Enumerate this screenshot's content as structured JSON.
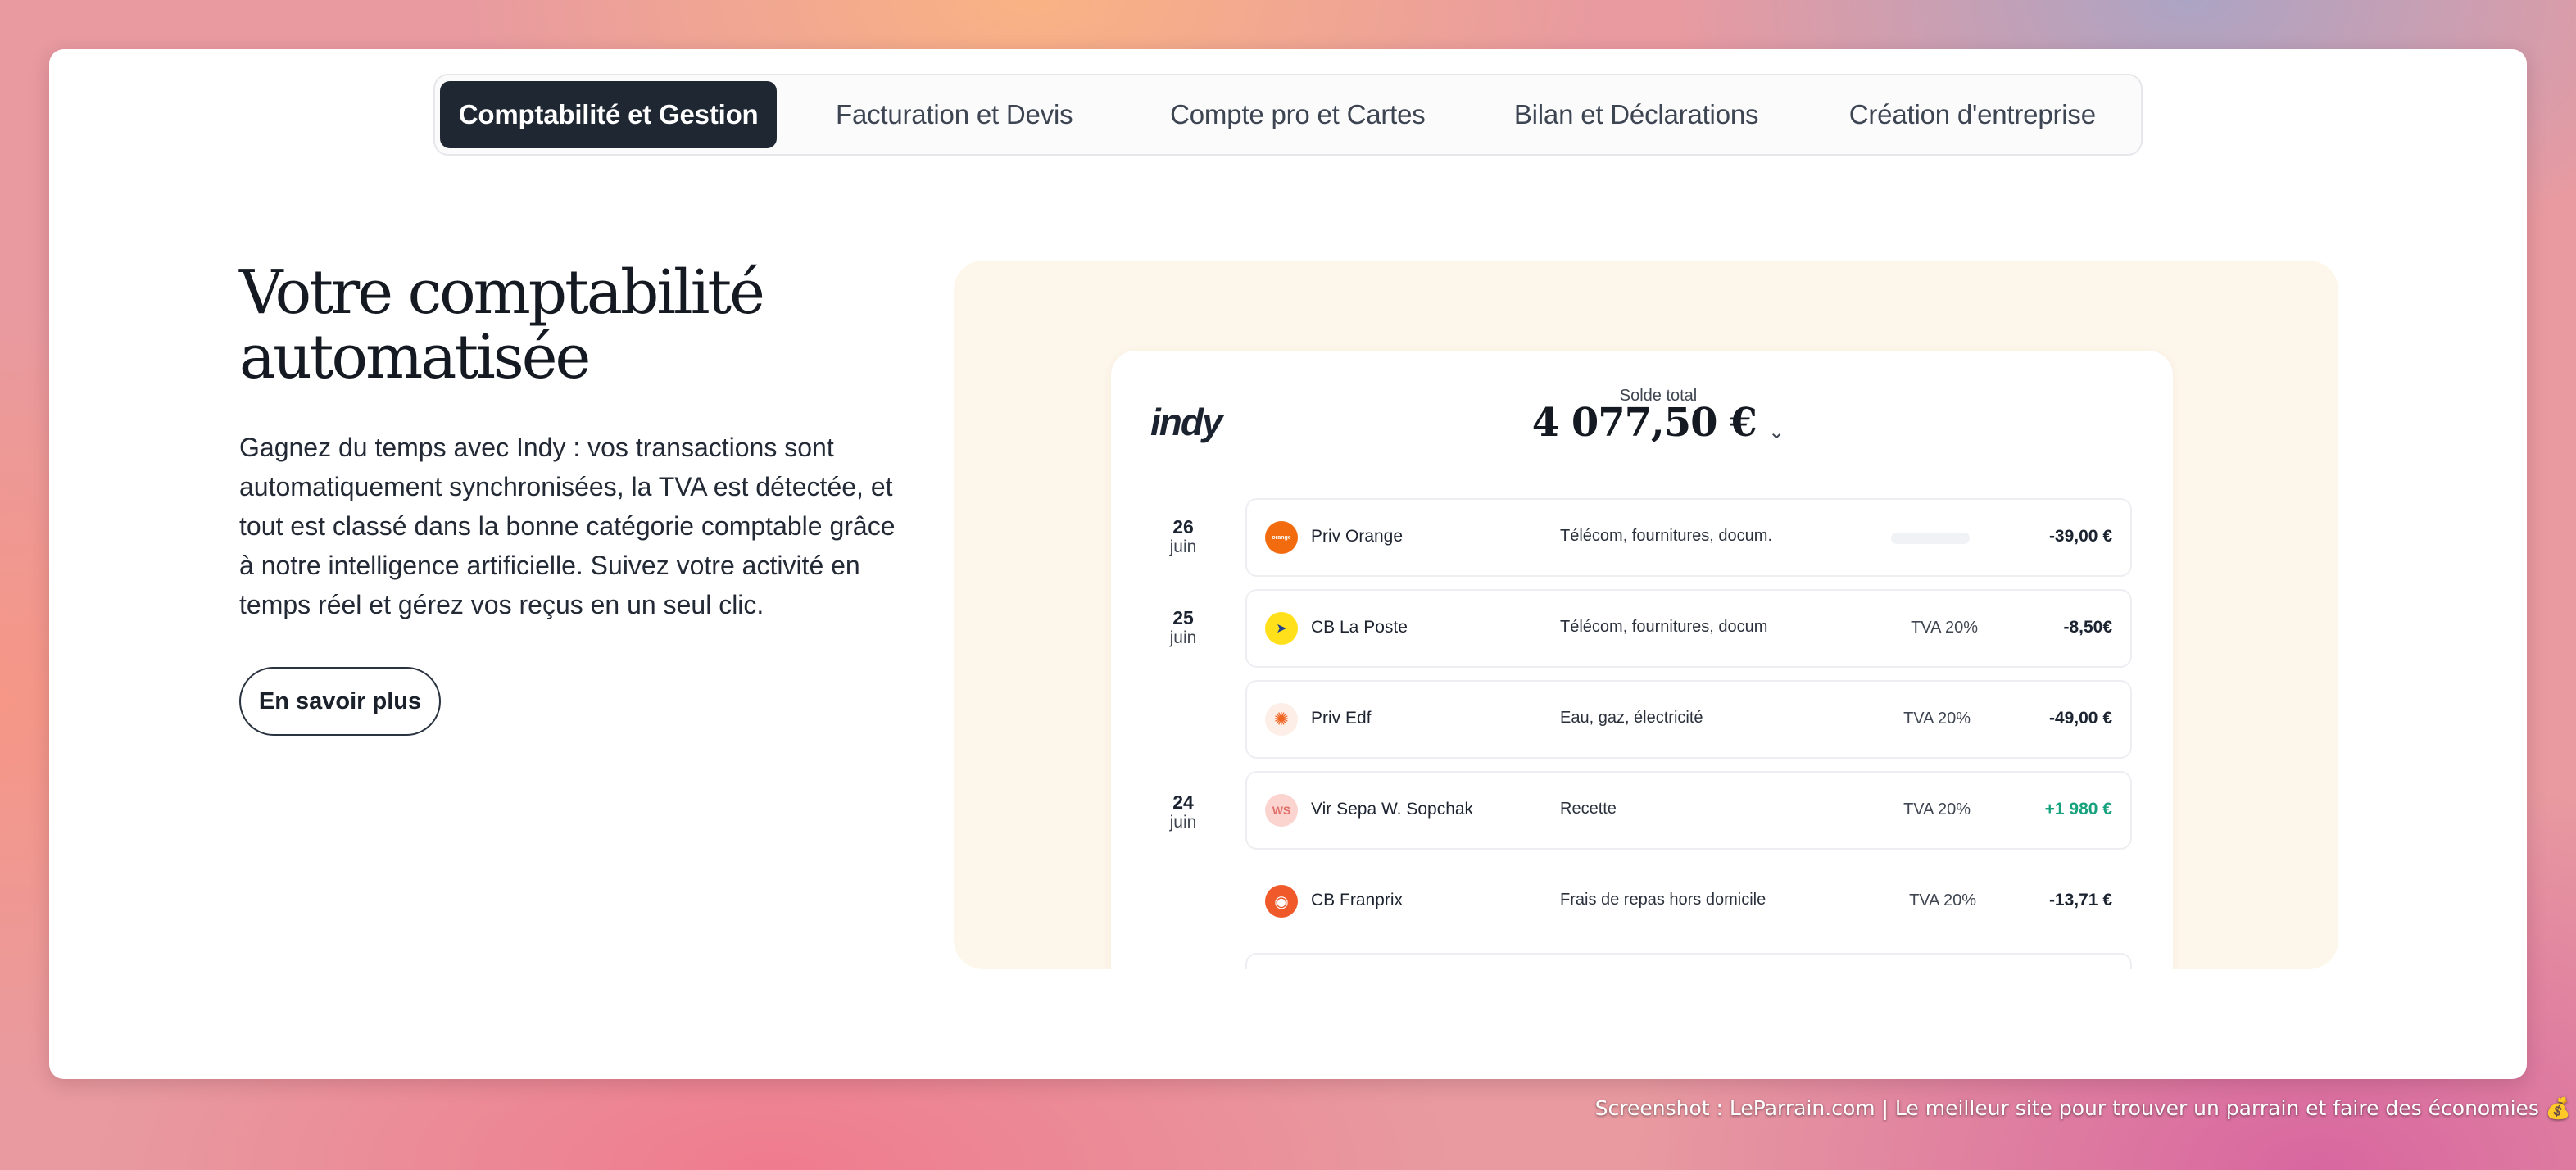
{
  "tabs": [
    {
      "label": "Comptabilité et Gestion",
      "active": true
    },
    {
      "label": "Facturation et Devis",
      "active": false
    },
    {
      "label": "Compte pro et Cartes",
      "active": false
    },
    {
      "label": "Bilan et Déclarations",
      "active": false
    },
    {
      "label": "Création d'entreprise",
      "active": false
    }
  ],
  "hero": {
    "title_line1": "Votre comptabilité",
    "title_line2": "automatisée",
    "description": "Gagnez du temps avec Indy : vos transactions sont automatiquement synchronisées, la TVA est détectée, et tout est classé dans la bonne catégorie comptable grâce à notre intelligence artificielle. Suivez votre activité en temps réel et gérez vos reçus en un seul clic.",
    "cta_label": "En savoir plus"
  },
  "app": {
    "logo": "indy",
    "balance_label": "Solde total",
    "balance_value": "4 077,50 €",
    "chevron": "⌄",
    "dates": [
      {
        "day": "26",
        "month": "juin"
      },
      {
        "day": "25",
        "month": "juin"
      },
      {
        "day": "24",
        "month": "juin"
      }
    ],
    "transactions": [
      {
        "merchant": "Priv Orange",
        "category": "Télécom, fournitures, docum.",
        "tva": "",
        "amount": "-39,00 €",
        "icon": "orange-logo-icon",
        "icon_text": "orange",
        "icon_bg": "#f26b0f",
        "icon_color": "#ffffff"
      },
      {
        "merchant": "CB La Poste",
        "category": "Télécom, fournitures, docum",
        "tva": "TVA 20%",
        "amount": "-8,50€",
        "icon": "la-poste-logo-icon",
        "icon_text": "➤",
        "icon_bg": "#ffe01b",
        "icon_color": "#1d3d8f"
      },
      {
        "merchant": "Priv Edf",
        "category": "Eau, gaz, électricité",
        "tva": "TVA 20%",
        "amount": "-49,00 €",
        "icon": "edf-logo-icon",
        "icon_text": "✺",
        "icon_bg": "#fdeee8",
        "icon_color": "#f26522"
      },
      {
        "merchant": "Vir Sepa W. Sopchak",
        "category": "Recette",
        "tva": "TVA 20%",
        "amount": "+1 980 €",
        "icon": "initials-avatar-icon",
        "icon_text": "WS",
        "icon_bg": "#fbd3cf",
        "icon_color": "#e0706a"
      },
      {
        "merchant": "CB Franprix",
        "category": "Frais de repas hors domicile",
        "tva": "TVA 20%",
        "amount": "-13,71 €",
        "icon": "franprix-logo-icon",
        "icon_text": "◉",
        "icon_bg": "#f0592a",
        "icon_color": "#ffffff"
      }
    ]
  },
  "footer_note": "Screenshot : LeParrain.com | Le meilleur site pour trouver un parrain et faire des économies 💰",
  "colors": {
    "tab_active_bg": "#1f2832",
    "panel_bg": "#fdf6ea",
    "positive_amount": "#17a27e"
  }
}
